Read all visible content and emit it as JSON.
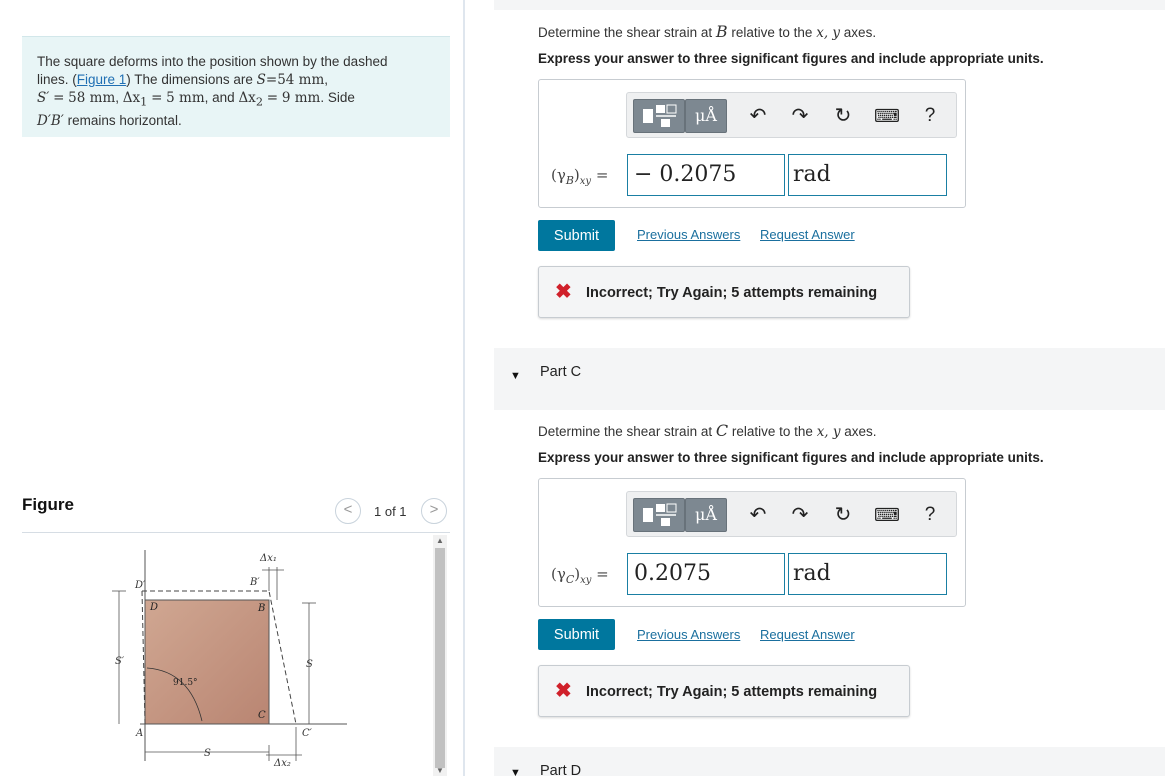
{
  "problem": {
    "text_line1": "The square deforms into the position shown by the dashed",
    "text_line2_a": "lines. (",
    "figure_link": "Figure 1",
    "text_line2_b": ") The dimensions are",
    "s_sym": "S",
    "eq": "=",
    "s_val": "54 mm",
    "sp_sym": "S′",
    "sp_val": "58 mm",
    "dx1_sym": "Δx",
    "sub1": "1",
    "dx1_val": "5 mm",
    "and": ", and",
    "dx2_sym": "Δx",
    "sub2": "2",
    "dx2_val": "9 mm",
    "side_word": ". Side",
    "side_label": "D′B′",
    "side_rest": "remains horizontal."
  },
  "figure": {
    "title": "Figure",
    "prev": "<",
    "next": ">",
    "counter": "1 of 1",
    "labels": {
      "dx1": "Δx₁",
      "dx2": "Δx₂",
      "D_prime": "D′",
      "B_prime": "B′",
      "D": "D",
      "B": "B",
      "C": "C",
      "C_prime": "C′",
      "A": "A",
      "S_prime": "S′",
      "S_side": "S",
      "S_bottom": "S",
      "angle": "91.5°"
    }
  },
  "part_b": {
    "question_a": "Determine the shear strain at",
    "point": "B",
    "question_b": "relative to the",
    "axes": "x, y",
    "question_c": "axes.",
    "instruction": "Express your answer to three significant figures and include appropriate units.",
    "label_gamma": "(γ",
    "label_sub_point": "B",
    "label_sub_axes": "xy",
    "label_eq": ") =",
    "value": "− 0.2075",
    "unit": "rad",
    "submit": "Submit",
    "previous_answers": "Previous Answers",
    "request_answer": "Request Answer",
    "feedback": "Incorrect; Try Again; 5 attempts remaining"
  },
  "part_c": {
    "part_label": "Part C",
    "question_a": "Determine the shear strain at",
    "point": "C",
    "question_b": "relative to the",
    "axes": "x, y",
    "question_c": "axes.",
    "instruction": "Express your answer to three significant figures and include appropriate units.",
    "label_gamma": "(γ",
    "label_sub_point": "C",
    "label_sub_axes": "xy",
    "label_eq": ") =",
    "value": "0.2075",
    "unit": "rad",
    "submit": "Submit",
    "previous_answers": "Previous Answers",
    "request_answer": "Request Answer",
    "feedback": "Incorrect; Try Again; 5 attempts remaining"
  },
  "part_d": {
    "part_label": "Part D"
  },
  "toolbar": {
    "units_label": "μÅ",
    "undo": "↶",
    "redo": "↷",
    "reset": "↻",
    "keyboard": "⌨",
    "help": "?"
  },
  "colors": {
    "accent": "#00779e",
    "problem_bg": "#e8f5f6",
    "error": "#d0202a",
    "square_fill": "#c89a86"
  }
}
